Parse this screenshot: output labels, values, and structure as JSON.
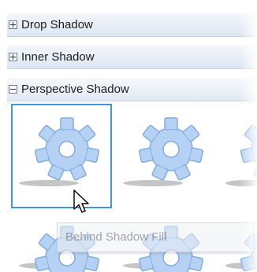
{
  "groups": [
    {
      "label": "Drop Shadow",
      "expanded": false
    },
    {
      "label": "Inner Shadow",
      "expanded": false
    },
    {
      "label": "Perspective Shadow",
      "expanded": true
    }
  ],
  "gallery": {
    "item_icon": "gear-icon",
    "selected_index": 0,
    "tooltip": "Behind Shadow Fill"
  },
  "colors": {
    "gear_fill": "#b5d2f4",
    "gear_stroke": "#86ade0",
    "selection_border": "#3d95e6"
  }
}
